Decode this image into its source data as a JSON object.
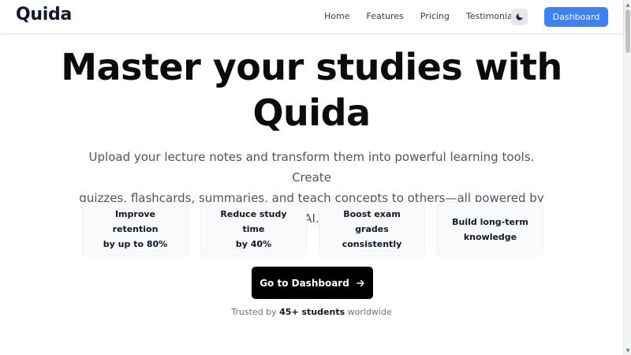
{
  "nav": {
    "logo": "Quida",
    "links": [
      "Home",
      "Features",
      "Pricing",
      "Testimonials"
    ],
    "theme_toggle_icon": "moon-icon",
    "dashboard_label": "Dashboard"
  },
  "hero": {
    "title_line1": "Master your studies with",
    "title_line2": "Quida",
    "subtitle_line1": "Upload your lecture notes and transform them into powerful learning tools. Create",
    "subtitle_line2": "quizzes, flashcards, summaries, and teach concepts to others—all powered by AI."
  },
  "features": [
    {
      "line1": "Improve retention",
      "line2": "by up to 80%"
    },
    {
      "line1": "Reduce study time",
      "line2": "by 40%"
    },
    {
      "line1": "Boost exam grades",
      "line2": "consistently"
    },
    {
      "line1": "Build long-term",
      "line2": "knowledge"
    }
  ],
  "cta": {
    "label": "Go to Dashboard",
    "icon": "arrow-right-icon"
  },
  "trust": {
    "prefix": "Trusted by",
    "count": "45+ students",
    "suffix": "worldwide"
  },
  "colors": {
    "accent": "#3b82f6",
    "cta_bg": "#000000",
    "card_bg": "#f9fafb",
    "muted_text": "#4b5563"
  }
}
